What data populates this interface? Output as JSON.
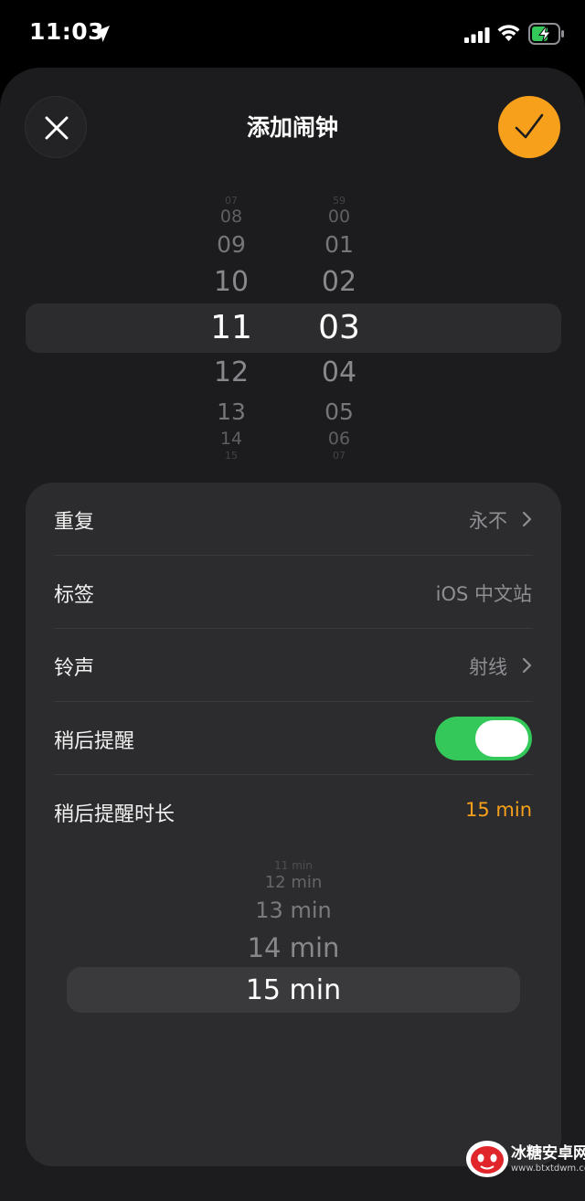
{
  "status_bar": {
    "time": "11:03",
    "icons": [
      "location-arrow-icon",
      "cellular-signal-icon",
      "wifi-icon",
      "battery-charging-icon"
    ]
  },
  "header": {
    "title": "添加闹钟",
    "close_icon": "close-icon",
    "confirm_icon": "checkmark-icon",
    "accent_color": "#f7a01c"
  },
  "time_picker": {
    "hours": [
      "07",
      "08",
      "09",
      "10",
      "11",
      "12",
      "13",
      "14",
      "15"
    ],
    "minutes": [
      "59",
      "00",
      "01",
      "02",
      "03",
      "04",
      "05",
      "06",
      "07"
    ],
    "selected_hour": "11",
    "selected_minute": "03"
  },
  "settings": {
    "repeat": {
      "label": "重复",
      "value": "永不"
    },
    "label": {
      "label": "标签",
      "value": "iOS 中文站"
    },
    "sound": {
      "label": "铃声",
      "value": "射线"
    },
    "snooze": {
      "label": "稍后提醒",
      "enabled": true,
      "toggle_color": "#34c759"
    },
    "snooze_duration": {
      "label": "稍后提醒时长",
      "value": "15 min"
    }
  },
  "snooze_picker": {
    "items": [
      "11 min",
      "12 min",
      "13 min",
      "14 min",
      "15 min"
    ],
    "selected": "15 min"
  },
  "watermark": {
    "title": "冰糖安卓网",
    "url": "www.btxtdwm.com"
  }
}
